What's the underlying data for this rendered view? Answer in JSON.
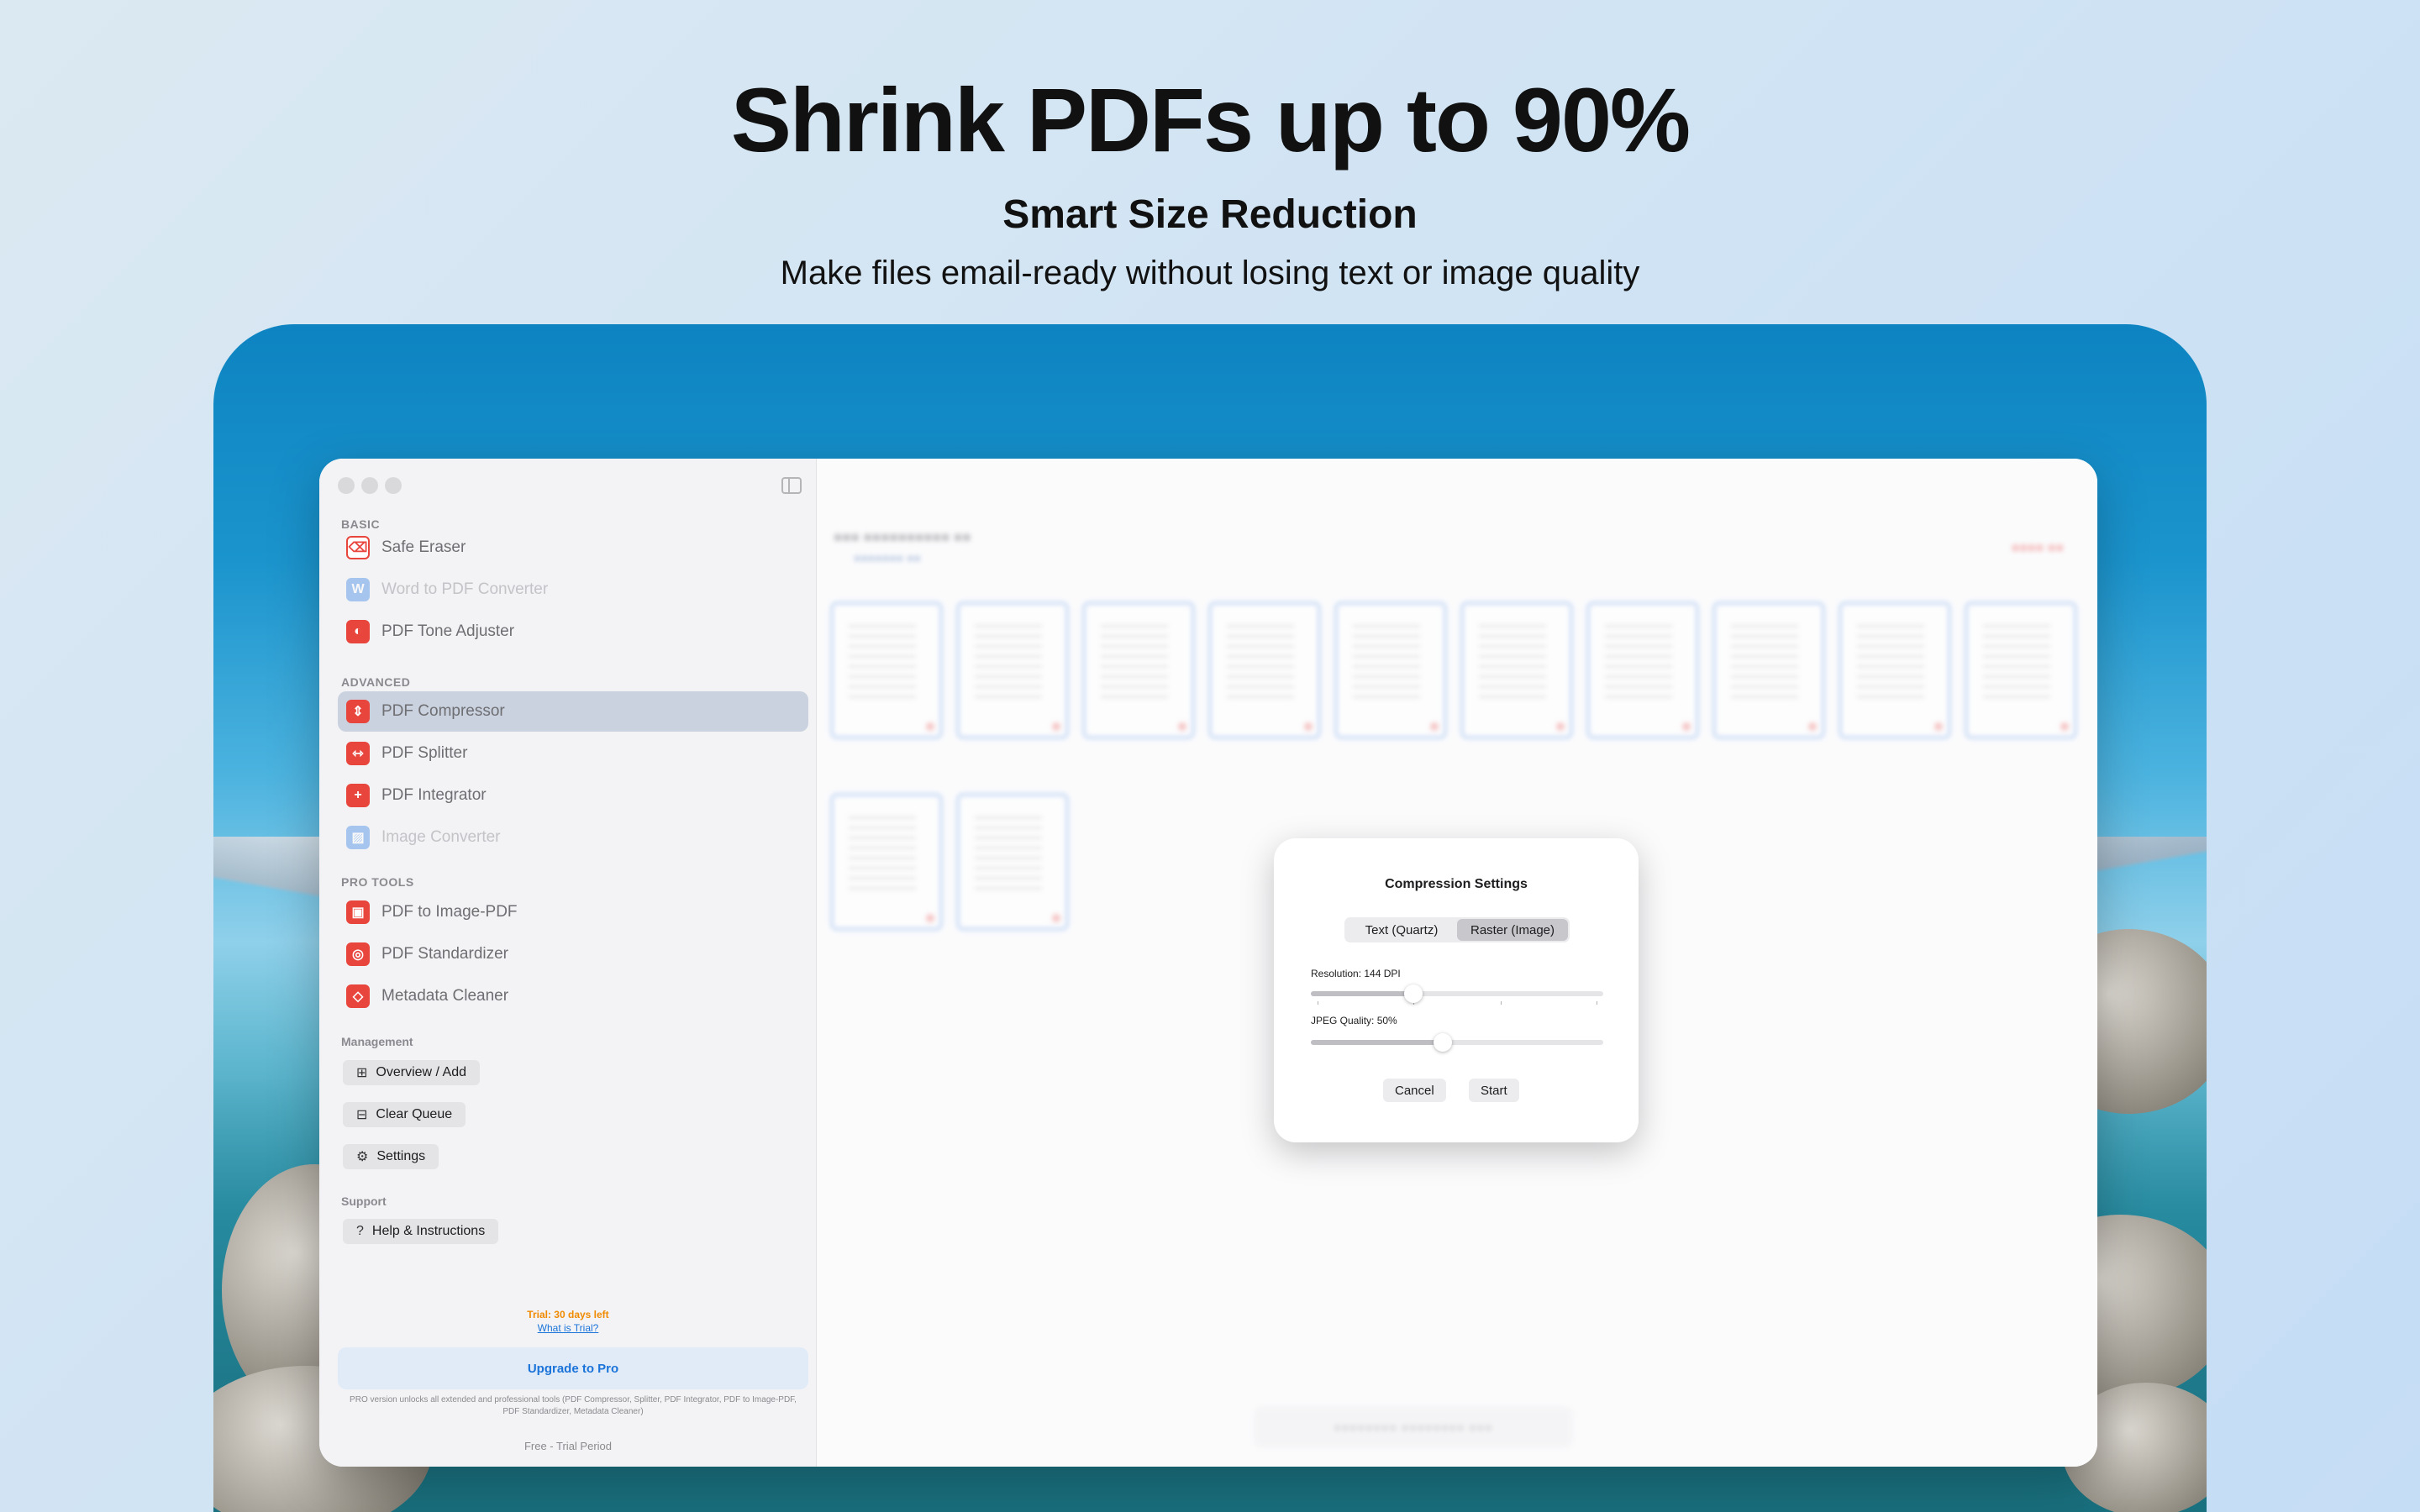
{
  "hero": {
    "title": "Shrink PDFs up to 90%",
    "subtitle": "Smart Size Reduction",
    "description": "Make files email-ready without losing text or image quality"
  },
  "sidebar": {
    "sections": {
      "basic": "BASIC",
      "advanced": "ADVANCED",
      "pro_tools": "PRO TOOLS",
      "management": "Management",
      "support": "Support"
    },
    "basic_items": [
      {
        "label": "Safe Eraser",
        "icon": "trash-icon",
        "color": "#e8453c"
      },
      {
        "label": "Word to PDF Converter",
        "icon": "document-icon",
        "color": "#4a8fe7"
      },
      {
        "label": "PDF Tone Adjuster",
        "icon": "contrast-icon",
        "color": "#e8453c"
      }
    ],
    "advanced_items": [
      {
        "label": "PDF Compressor",
        "icon": "compress-icon",
        "color": "#e8453c"
      },
      {
        "label": "PDF Splitter",
        "icon": "split-icon",
        "color": "#e8453c"
      },
      {
        "label": "PDF Integrator",
        "icon": "plus-icon",
        "color": "#e8453c"
      },
      {
        "label": "Image Converter",
        "icon": "image-icon",
        "color": "#4a8fe7"
      }
    ],
    "pro_items": [
      {
        "label": "PDF to Image-PDF",
        "icon": "image-pdf-icon",
        "color": "#e8453c"
      },
      {
        "label": "PDF Standardizer",
        "icon": "standard-icon",
        "color": "#e8453c"
      },
      {
        "label": "Metadata Cleaner",
        "icon": "eraser-icon",
        "color": "#e8453c"
      }
    ],
    "management_buttons": [
      {
        "label": "Overview / Add",
        "icon": "folder-add-icon"
      },
      {
        "label": "Clear Queue",
        "icon": "tray-icon"
      },
      {
        "label": "Settings",
        "icon": "gear-icon"
      }
    ],
    "support_buttons": [
      {
        "label": "Help & Instructions",
        "icon": "question-icon"
      }
    ],
    "trial_status": "Trial: 30 days left",
    "trial_link": "What is Trial?",
    "upgrade_label": "Upgrade to Pro",
    "pro_note": "PRO version unlocks all extended and professional tools (PDF Compressor, Splitter, PDF Integrator, PDF to Image-PDF, PDF Standardizer, Metadata Cleaner)",
    "plan": "Free - Trial Period"
  },
  "dialog": {
    "title": "Compression Settings",
    "modes": [
      "Text (Quartz)",
      "Raster (Image)"
    ],
    "active_mode": "Raster (Image)",
    "resolution_label": "Resolution: 144 DPI",
    "resolution_fraction": 0.35,
    "jpeg_label": "JPEG Quality: 50%",
    "jpeg_fraction": 0.45,
    "cancel_label": "Cancel",
    "start_label": "Start"
  },
  "colors": {
    "accent": "#1a73d9",
    "trial": "#f08a00",
    "danger": "#e8453c"
  }
}
